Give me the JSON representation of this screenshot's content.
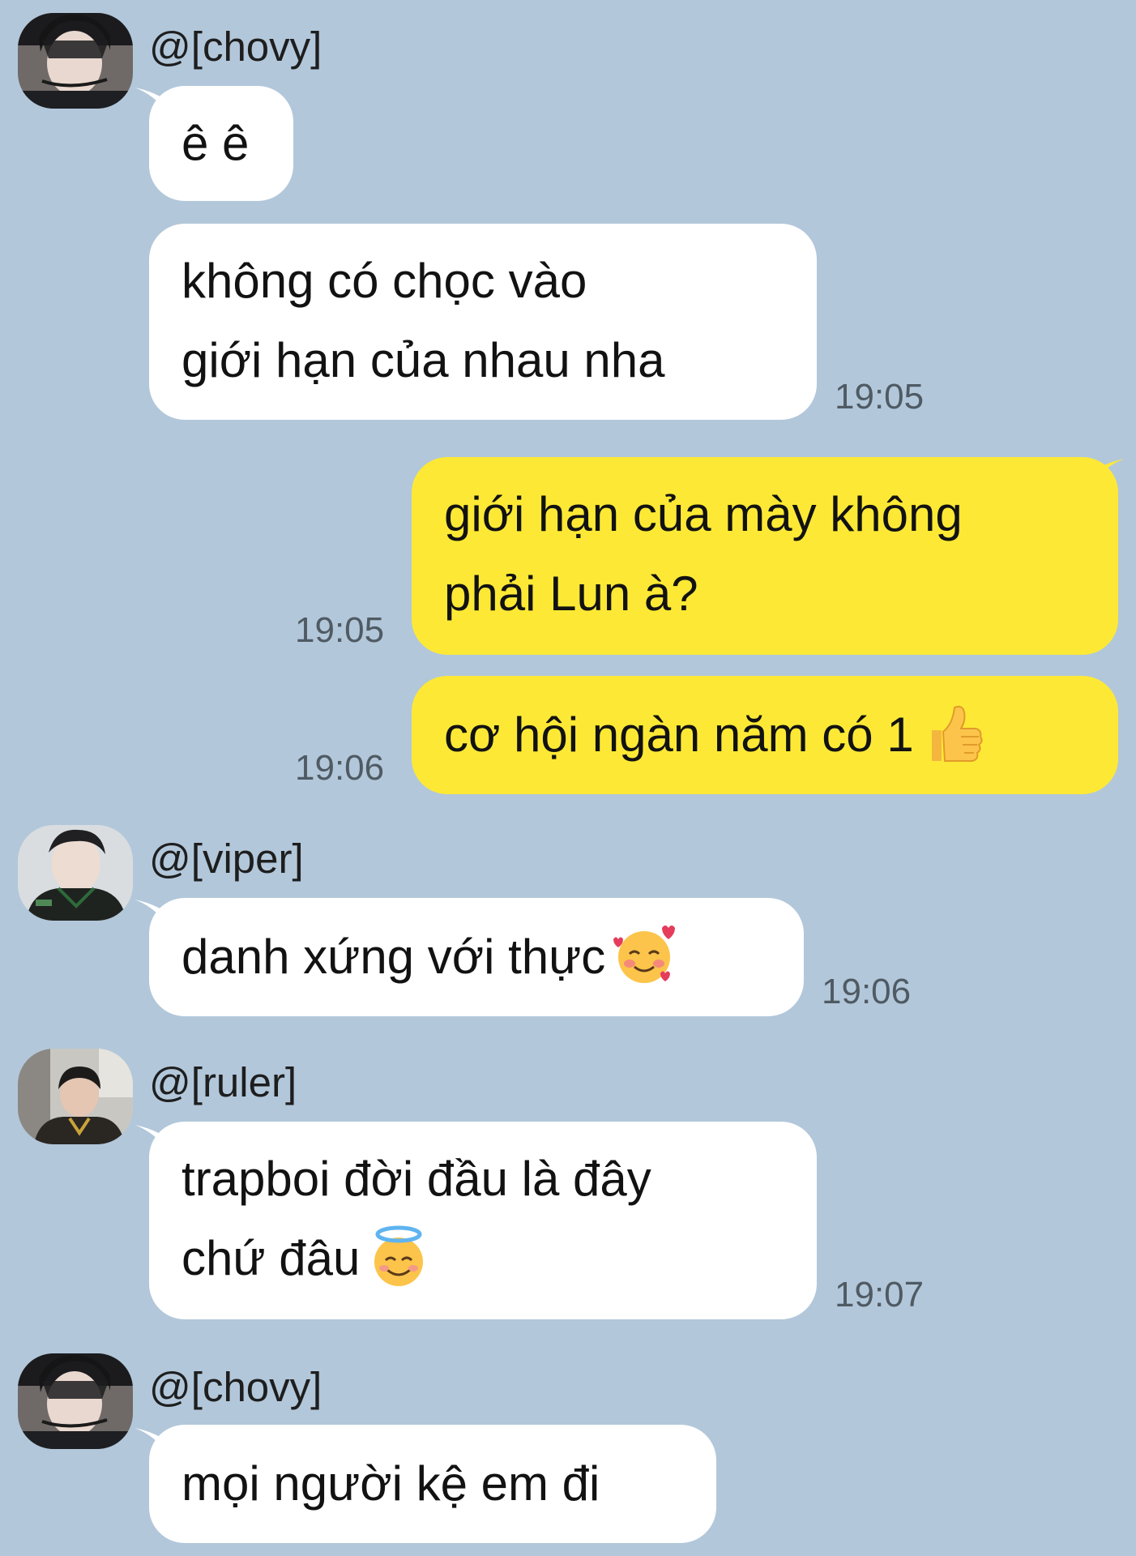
{
  "messages": [
    {
      "sender": "@[chovy]",
      "bubbles": [
        {
          "lines": [
            "ê ê"
          ]
        },
        {
          "lines": [
            "không có chọc vào",
            "giới hạn của nhau nha"
          ],
          "time": "19:05"
        }
      ]
    },
    {
      "outgoing": true,
      "bubbles": [
        {
          "lines": [
            "giới hạn của mày không",
            "phải Lun à?"
          ],
          "time": "19:05"
        },
        {
          "lines": [
            "cơ hội ngàn năm có 1"
          ],
          "emoji": "thumbs-up-icon",
          "time": "19:06"
        }
      ]
    },
    {
      "sender": "@[viper]",
      "bubbles": [
        {
          "lines": [
            "danh xứng với thực"
          ],
          "emoji": "smiling-face-with-hearts-icon",
          "time": "19:06"
        }
      ]
    },
    {
      "sender": "@[ruler]",
      "bubbles": [
        {
          "lines": [
            "trapboi đời đầu là đây",
            "chứ đâu"
          ],
          "emoji": "smiling-face-with-halo-icon",
          "time": "19:07"
        }
      ]
    },
    {
      "sender": "@[chovy]",
      "bubbles": [
        {
          "lines": [
            "mọi người kệ em đi"
          ]
        }
      ]
    }
  ],
  "colors": {
    "background": "#b2c7da",
    "incoming_bubble": "#ffffff",
    "outgoing_bubble": "#fde935",
    "timestamp": "#4f5a63"
  }
}
